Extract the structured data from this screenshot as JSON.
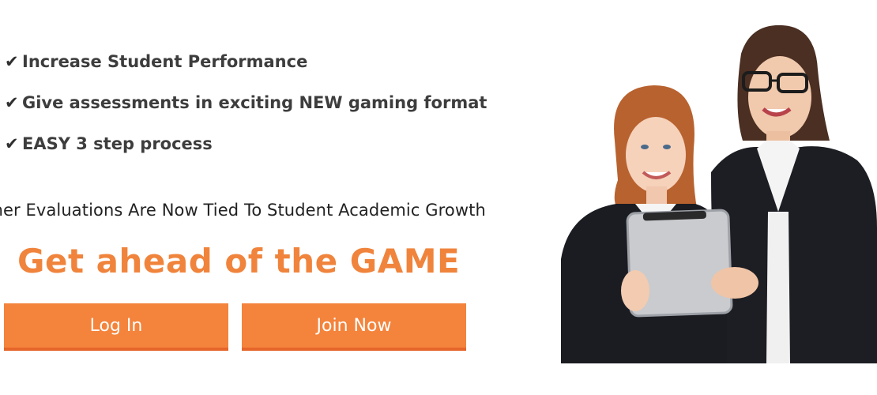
{
  "benefits": {
    "items": [
      "Increase Student Performance",
      "Give assessments in exciting NEW gaming format",
      "EASY 3 step process"
    ],
    "check_glyph": "✔"
  },
  "tagline": "acher Evaluations Are Now Tied To Student  Academic Growth",
  "headline": "Get ahead of the GAME",
  "buttons": {
    "login_label": "Log In",
    "join_label": "Join Now"
  },
  "colors": {
    "accent": "#f4833b",
    "accent_dark": "#e5652a",
    "headline": "#f0843c",
    "text": "#3d3d3d"
  },
  "icons": {
    "check": "check-icon",
    "photo": "teacher-student-tablet-photo"
  }
}
